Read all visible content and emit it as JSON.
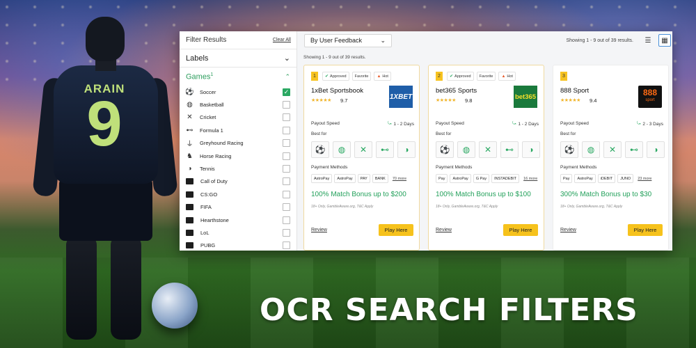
{
  "background": {
    "player": {
      "name": "ARAIN",
      "number": "9"
    },
    "caption": "OCR SEARCH FILTERS"
  },
  "sidebar": {
    "title": "Filter Results",
    "clear_all": "Clear All",
    "labels_section": "Labels",
    "games_section": "Games",
    "games_count": "1",
    "games": [
      {
        "name": "Soccer",
        "icon": "soccer-ball-icon",
        "checked": true
      },
      {
        "name": "Basketball",
        "icon": "basketball-icon",
        "checked": false
      },
      {
        "name": "Cricket",
        "icon": "cricket-icon",
        "checked": false
      },
      {
        "name": "Formula 1",
        "icon": "race-car-icon",
        "checked": false
      },
      {
        "name": "Greyhound Racing",
        "icon": "greyhound-icon",
        "checked": false
      },
      {
        "name": "Horse Racing",
        "icon": "horse-icon",
        "checked": false
      },
      {
        "name": "Tennis",
        "icon": "tennis-ball-icon",
        "checked": false
      },
      {
        "name": "Call of Duty",
        "icon": "call-of-duty-icon",
        "checked": false
      },
      {
        "name": "CS:GO",
        "icon": "csgo-icon",
        "checked": false
      },
      {
        "name": "FIFA",
        "icon": "fifa-icon",
        "checked": false
      },
      {
        "name": "Hearthstone",
        "icon": "hearthstone-icon",
        "checked": false
      },
      {
        "name": "LoL",
        "icon": "lol-icon",
        "checked": false
      },
      {
        "name": "PUBG",
        "icon": "pubg-icon",
        "checked": false
      }
    ]
  },
  "toolbar": {
    "sort_value": "By User Feedback",
    "showing_right": "Showing 1 - 9 out of 39 results.",
    "showing_left": "Showing 1 - 9 out of 39 results.",
    "view_modes": [
      "list",
      "grid"
    ],
    "active_view": "grid"
  },
  "cards": [
    {
      "rank": "1",
      "badges": {
        "approved": "Approved",
        "favorite": "Favorite",
        "hot": "Hot"
      },
      "name": "1xBet Sportsbook",
      "rating": "9.7",
      "stars": "★★★★★",
      "logo_text": "1XBET",
      "payout_label": "Payout Speed",
      "payout_value": "1 - 2 Days",
      "best_for_label": "Best for",
      "payment_label": "Payment Methods",
      "payments": [
        "AstroPay",
        "AstroPay",
        "PAY",
        "BANK"
      ],
      "payments_more": "70 more",
      "bonus": "100% Match Bonus up to $200",
      "terms": "18+ Only, GambleAware.org, T&C Apply",
      "review": "Review",
      "play": "Play Here"
    },
    {
      "rank": "2",
      "badges": {
        "approved": "Approved",
        "favorite": "Favorite",
        "hot": "Hot"
      },
      "name": "bet365 Sports",
      "rating": "9.8",
      "stars": "★★★★★",
      "logo_text": "bet365",
      "payout_label": "Payout Speed",
      "payout_value": "1 - 2 Days",
      "best_for_label": "Best for",
      "payment_label": "Payment Methods",
      "payments": [
        "Pay",
        "AstroPay",
        "G Pay",
        "INSTADEBIT"
      ],
      "payments_more": "16 more",
      "bonus": "100% Match Bonus up to $100",
      "terms": "18+ Only, GambleAware.org, T&C Apply",
      "review": "Review",
      "play": "Play Here"
    },
    {
      "rank": "3",
      "name": "888 Sport",
      "rating": "9.4",
      "stars": "★★★★★",
      "logo_text": "888",
      "logo_sub": "sport",
      "payout_label": "Payout Speed",
      "payout_value": "2 - 3 Days",
      "best_for_label": "Best for",
      "payment_label": "Payment Methods",
      "payments": [
        "Pay",
        "AstroPay",
        "iDEBIT",
        "JUNO"
      ],
      "payments_more": "23 more",
      "bonus": "300% Match Bonus up to $30",
      "terms": "18+ Only, GambleAware.org, T&C Apply",
      "review": "Review",
      "play": "Play Here"
    }
  ],
  "best_for_icons": [
    "soccer-ball-icon",
    "basketball-icon",
    "cricket-icon",
    "race-car-icon",
    "tennis-ball-icon"
  ],
  "colors": {
    "accent_green": "#2aa862",
    "play_yellow": "#f6c21c",
    "rank_yellow": "#f7c321"
  }
}
